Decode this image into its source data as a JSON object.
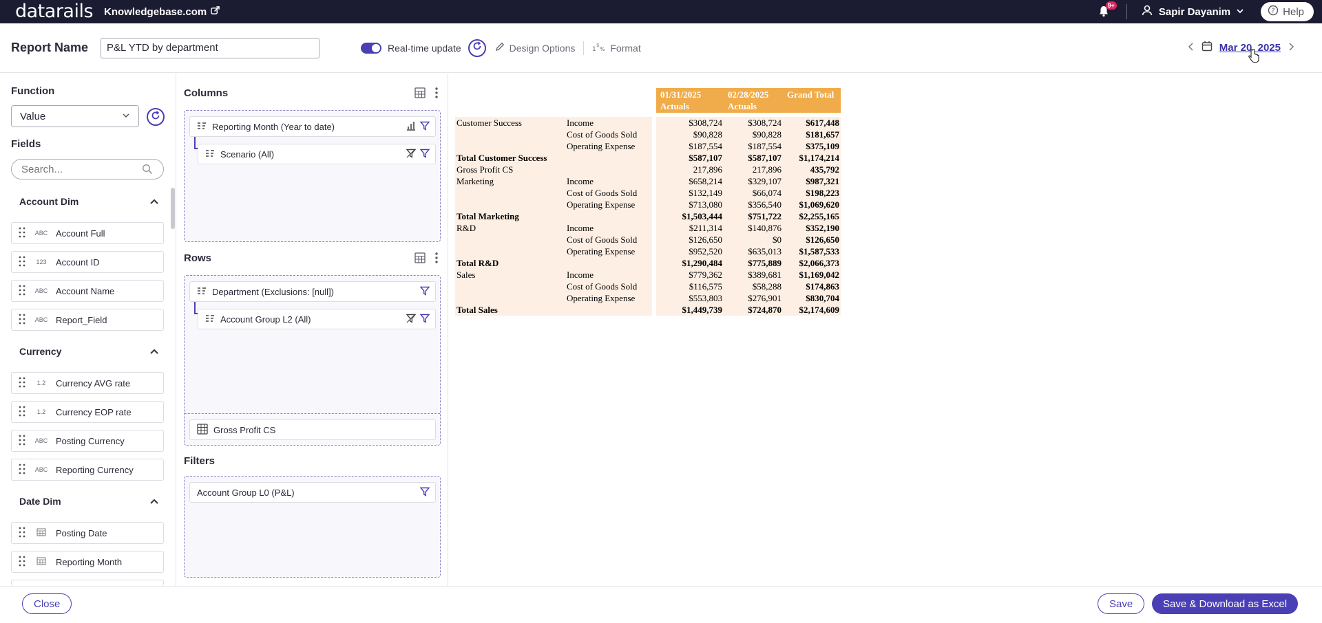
{
  "topbar": {
    "logo": "datarails",
    "site": "Knowledgebase.com",
    "notifications_badge": "9+",
    "user_name": "Sapir Dayanim",
    "help_label": "Help"
  },
  "header": {
    "report_name_label": "Report Name",
    "report_name_value": "P&L YTD by department",
    "realtime_label": "Real-time update",
    "design_options_label": "Design Options",
    "format_label": "Format",
    "date_value": "Mar 20, 2025"
  },
  "left": {
    "function_label": "Function",
    "function_value": "Value",
    "fields_label": "Fields",
    "search_placeholder": "Search...",
    "groups": [
      {
        "title": "Account Dim",
        "fields": [
          {
            "type": "ABC",
            "name": "Account Full"
          },
          {
            "type": "123",
            "name": "Account ID"
          },
          {
            "type": "ABC",
            "name": "Account Name"
          },
          {
            "type": "ABC",
            "name": "Report_Field"
          }
        ]
      },
      {
        "title": "Currency",
        "fields": [
          {
            "type": "1.2",
            "name": "Currency AVG rate"
          },
          {
            "type": "1.2",
            "name": "Currency EOP rate"
          },
          {
            "type": "ABC",
            "name": "Posting Currency"
          },
          {
            "type": "ABC",
            "name": "Reporting Currency"
          }
        ]
      },
      {
        "title": "Date Dim",
        "fields": [
          {
            "type": "cal",
            "name": "Posting Date"
          },
          {
            "type": "cal",
            "name": "Reporting Month"
          }
        ]
      }
    ]
  },
  "middle": {
    "columns_title": "Columns",
    "columns_items": [
      "Reporting Month (Year to date)",
      "Scenario (All)"
    ],
    "rows_title": "Rows",
    "rows_items": [
      "Department (Exclusions: [null])",
      "Account Group L2 (All)"
    ],
    "rows_extra": "Gross Profit CS",
    "filters_title": "Filters",
    "filters_items": [
      "Account Group L0 (P&L)"
    ]
  },
  "pivot": {
    "col_headers": [
      {
        "line1": "01/31/2025",
        "line2": "Actuals"
      },
      {
        "line1": "02/28/2025",
        "line2": "Actuals"
      },
      {
        "line1": "Grand Total",
        "line2": ""
      }
    ],
    "rows": [
      {
        "dept": "Customer Success",
        "acct": "Income",
        "v1": "$308,724",
        "v2": "$308,724",
        "t": "$617,448",
        "bold": false
      },
      {
        "dept": "",
        "acct": "Cost of Goods Sold",
        "v1": "$90,828",
        "v2": "$90,828",
        "t": "$181,657",
        "bold": false
      },
      {
        "dept": "",
        "acct": "Operating Expense",
        "v1": "$187,554",
        "v2": "$187,554",
        "t": "$375,109",
        "bold": false
      },
      {
        "dept": "Total Customer Success",
        "acct": "",
        "v1": "$587,107",
        "v2": "$587,107",
        "t": "$1,174,214",
        "bold": true
      },
      {
        "dept": "Gross Profit CS",
        "acct": "",
        "v1": "217,896",
        "v2": "217,896",
        "t": "435,792",
        "bold": false
      },
      {
        "dept": "Marketing",
        "acct": "Income",
        "v1": "$658,214",
        "v2": "$329,107",
        "t": "$987,321",
        "bold": false
      },
      {
        "dept": "",
        "acct": "Cost of Goods Sold",
        "v1": "$132,149",
        "v2": "$66,074",
        "t": "$198,223",
        "bold": false
      },
      {
        "dept": "",
        "acct": "Operating Expense",
        "v1": "$713,080",
        "v2": "$356,540",
        "t": "$1,069,620",
        "bold": false
      },
      {
        "dept": "Total Marketing",
        "acct": "",
        "v1": "$1,503,444",
        "v2": "$751,722",
        "t": "$2,255,165",
        "bold": true
      },
      {
        "dept": "R&D",
        "acct": "Income",
        "v1": "$211,314",
        "v2": "$140,876",
        "t": "$352,190",
        "bold": false
      },
      {
        "dept": "",
        "acct": "Cost of Goods Sold",
        "v1": "$126,650",
        "v2": "$0",
        "t": "$126,650",
        "bold": false
      },
      {
        "dept": "",
        "acct": "Operating Expense",
        "v1": "$952,520",
        "v2": "$635,013",
        "t": "$1,587,533",
        "bold": false
      },
      {
        "dept": "Total R&D",
        "acct": "",
        "v1": "$1,290,484",
        "v2": "$775,889",
        "t": "$2,066,373",
        "bold": true
      },
      {
        "dept": "Sales",
        "acct": "Income",
        "v1": "$779,362",
        "v2": "$389,681",
        "t": "$1,169,042",
        "bold": false
      },
      {
        "dept": "",
        "acct": "Cost of Goods Sold",
        "v1": "$116,575",
        "v2": "$58,288",
        "t": "$174,863",
        "bold": false
      },
      {
        "dept": "",
        "acct": "Operating Expense",
        "v1": "$553,803",
        "v2": "$276,901",
        "t": "$830,704",
        "bold": false
      },
      {
        "dept": "Total Sales",
        "acct": "",
        "v1": "$1,449,739",
        "v2": "$724,870",
        "t": "$2,174,609",
        "bold": true
      }
    ]
  },
  "footer": {
    "close_label": "Close",
    "save_label": "Save",
    "save_download_label": "Save & Download as Excel"
  },
  "colors": {
    "topbar": "#1b1b32",
    "accent": "#4a3fb5",
    "pivot_header": "#f0ac4a",
    "pivot_cell": "#fdefe4"
  }
}
